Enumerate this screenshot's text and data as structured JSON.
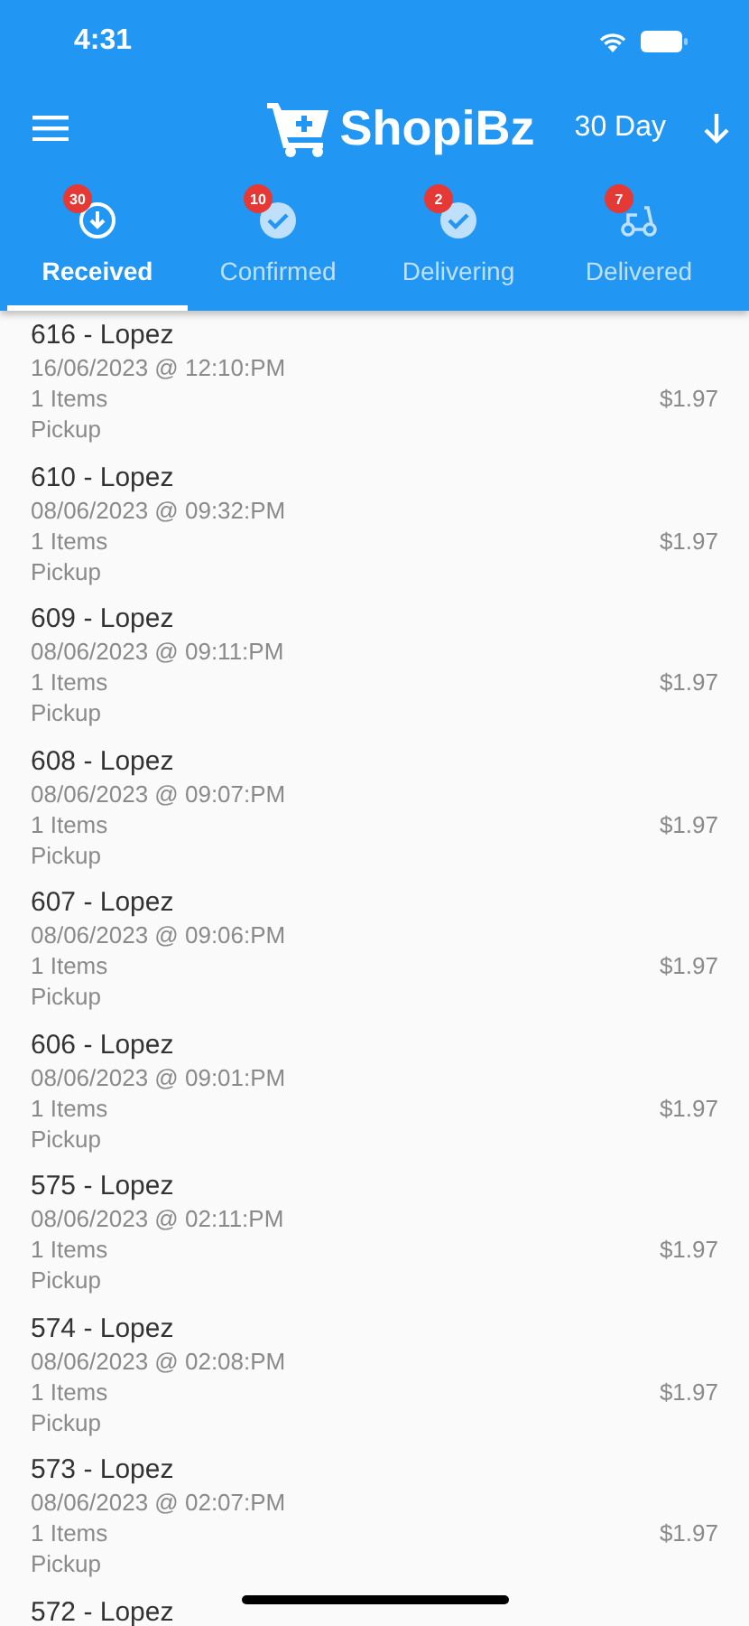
{
  "status_bar": {
    "time": "4:31"
  },
  "app_bar": {
    "logo": "ShopiBz",
    "period": "30 Day"
  },
  "tabs": [
    {
      "label": "Received",
      "badge": "30",
      "kind": "received",
      "selected": true
    },
    {
      "label": "Confirmed",
      "badge": "10",
      "kind": "confirmed",
      "selected": false
    },
    {
      "label": "Delivering",
      "badge": "2",
      "kind": "delivering",
      "selected": false
    },
    {
      "label": "Delivered",
      "badge": "7",
      "kind": "delivered",
      "selected": false
    }
  ],
  "orders": [
    {
      "title": "616 - Lopez",
      "date": "16/06/2023 @ 12:10:PM",
      "items": "1 Items",
      "type": "Pickup",
      "total": "$1.97"
    },
    {
      "title": "610 - Lopez",
      "date": "08/06/2023 @ 09:32:PM",
      "items": "1 Items",
      "type": "Pickup",
      "total": "$1.97"
    },
    {
      "title": "609 - Lopez",
      "date": "08/06/2023 @ 09:11:PM",
      "items": "1 Items",
      "type": "Pickup",
      "total": "$1.97"
    },
    {
      "title": "608 - Lopez",
      "date": "08/06/2023 @ 09:07:PM",
      "items": "1 Items",
      "type": "Pickup",
      "total": "$1.97"
    },
    {
      "title": "607 - Lopez",
      "date": "08/06/2023 @ 09:06:PM",
      "items": "1 Items",
      "type": "Pickup",
      "total": "$1.97"
    },
    {
      "title": "606 - Lopez",
      "date": "08/06/2023 @ 09:01:PM",
      "items": "1 Items",
      "type": "Pickup",
      "total": "$1.97"
    },
    {
      "title": "575 - Lopez",
      "date": "08/06/2023 @ 02:11:PM",
      "items": "1 Items",
      "type": "Pickup",
      "total": "$1.97"
    },
    {
      "title": "574 - Lopez",
      "date": "08/06/2023 @ 02:08:PM",
      "items": "1 Items",
      "type": "Pickup",
      "total": "$1.97"
    },
    {
      "title": "573 - Lopez",
      "date": "08/06/2023 @ 02:07:PM",
      "items": "1 Items",
      "type": "Pickup",
      "total": "$1.97"
    },
    {
      "title": "572 - Lopez"
    }
  ]
}
